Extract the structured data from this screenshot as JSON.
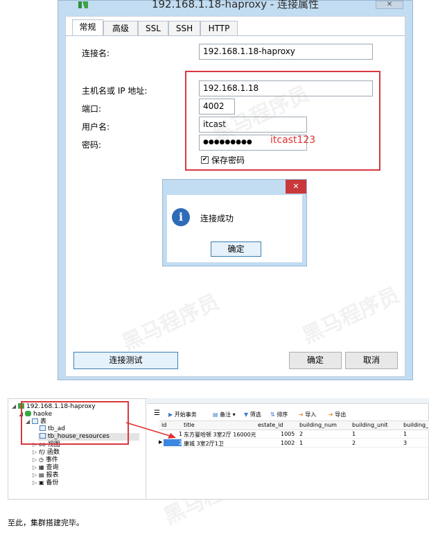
{
  "window": {
    "title": "192.168.1.18-haproxy - 连接属性",
    "close_glyph": "✕"
  },
  "tabs": [
    {
      "label": "常规",
      "active": true
    },
    {
      "label": "高级",
      "active": false
    },
    {
      "label": "SSL",
      "active": false
    },
    {
      "label": "SSH",
      "active": false
    },
    {
      "label": "HTTP",
      "active": false
    }
  ],
  "form": {
    "connection_name_label": "连接名:",
    "connection_name_value": "192.168.1.18-haproxy",
    "host_label": "主机名或 IP 地址:",
    "host_value": "192.168.1.18",
    "port_label": "端口:",
    "port_value": "4002",
    "user_label": "用户名:",
    "user_value": "itcast",
    "password_label": "密码:",
    "password_mask": "●●●●●●●●●",
    "password_note": "itcast123",
    "save_password_label": "保存密码",
    "save_password_checked": true
  },
  "message_box": {
    "close_glyph": "✕",
    "info_glyph": "i",
    "message": "连接成功",
    "ok_label": "确定"
  },
  "footer": {
    "test_button": "连接测试",
    "ok_button": "确定",
    "cancel_button": "取消"
  },
  "tree": {
    "connection": "192.168.1.18-haproxy",
    "database": "haoke",
    "tables_node": "表",
    "tables": [
      "tb_ad",
      "tb_house_resources"
    ],
    "others": [
      "视图",
      "函数",
      "事件",
      "查询",
      "报表",
      "备份"
    ]
  },
  "grid_toolbar": {
    "menu_glyph": "☰",
    "begin_tx": "开始事务",
    "memo": "备注",
    "filter": "筛选",
    "sort": "排序",
    "import": "导入",
    "export": "导出"
  },
  "grid": {
    "columns": [
      "id",
      "title",
      "estate_id",
      "building_num",
      "building_unit",
      "building_"
    ],
    "rows": [
      {
        "id": "1",
        "title": "东方曼哈顿 3室2厅 16000元",
        "estate_id": "1005",
        "building_num": "2",
        "building_unit": "1",
        "building_": "1"
      },
      {
        "id": "2",
        "title": "康城 3室2厅1卫",
        "estate_id": "1002",
        "building_num": "1",
        "building_unit": "2",
        "building_": "3"
      }
    ]
  },
  "caption": "至此，集群搭建完毕。",
  "colors": {
    "dialog_bg": "#c2dcf1",
    "highlight_red": "#d9363e",
    "info_blue": "#2f6bb8"
  }
}
